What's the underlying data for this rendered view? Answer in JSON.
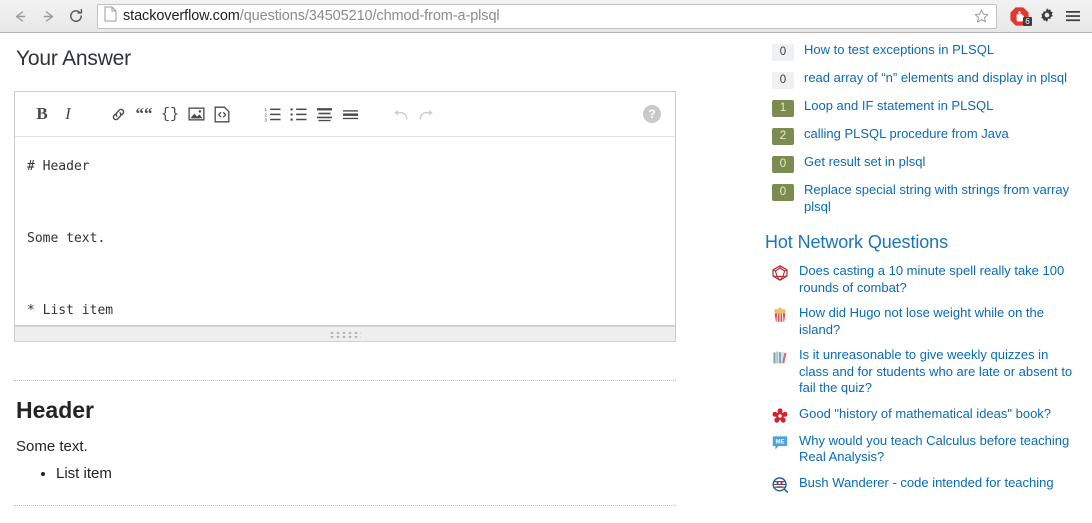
{
  "browser": {
    "back_label": "Back",
    "forward_label": "Forward",
    "reload_label": "Reload",
    "url_host": "stackoverflow.com",
    "url_path": "/questions/34505210/chmod-from-a-plsql",
    "page_icon": "document-icon",
    "star_label": "Bookmark",
    "extension": {
      "name": "adblock-icon",
      "badge": "6"
    },
    "settings_label": "Settings",
    "menu_label": "Menu"
  },
  "answer": {
    "heading": "Your Answer",
    "toolbar": [
      {
        "name": "bold",
        "glyph": "B"
      },
      {
        "name": "italic",
        "glyph": "I"
      },
      {
        "name": "link",
        "glyph": ""
      },
      {
        "name": "blockquote",
        "glyph": "““"
      },
      {
        "name": "code",
        "glyph": "{}"
      },
      {
        "name": "image",
        "glyph": ""
      },
      {
        "name": "code-snippet",
        "glyph": ""
      },
      {
        "name": "numbered-list",
        "glyph": ""
      },
      {
        "name": "bulleted-list",
        "glyph": ""
      },
      {
        "name": "heading",
        "glyph": ""
      },
      {
        "name": "horizontal-rule",
        "glyph": ""
      },
      {
        "name": "undo",
        "glyph": ""
      },
      {
        "name": "redo",
        "glyph": ""
      }
    ],
    "help_glyph": "?",
    "editor_text": "# Header\n\nSome text.\n\n* List item",
    "preview": {
      "heading": "Header",
      "paragraph": "Some text.",
      "list_items": [
        "List item"
      ]
    }
  },
  "sidebar": {
    "related": [
      {
        "votes": "0",
        "answered": false,
        "title": "How to test exceptions in PLSQL"
      },
      {
        "votes": "0",
        "answered": false,
        "title": "read array of “n” elements and display in plsql"
      },
      {
        "votes": "1",
        "answered": true,
        "title": "Loop and IF statement in PLSQL"
      },
      {
        "votes": "2",
        "answered": true,
        "title": "calling PLSQL procedure from Java"
      },
      {
        "votes": "0",
        "answered": true,
        "title": "Get result set in plsql"
      },
      {
        "votes": "0",
        "answered": true,
        "title": "Replace special string with strings from varray plsql"
      }
    ],
    "hot_network": {
      "title": "Hot Network Questions",
      "items": [
        {
          "icon": "rpg-d20-icon",
          "title": "Does casting a 10 minute spell really take 100 rounds of combat?"
        },
        {
          "icon": "popcorn-icon",
          "title": "How did Hugo not lose weight while on the island?"
        },
        {
          "icon": "books-icon",
          "title": "Is it unreasonable to give weekly quizzes in class and for students who are late or absent to fail the quiz?"
        },
        {
          "icon": "red-flower-icon",
          "title": "Good \"history of mathematical ideas\" book?"
        },
        {
          "icon": "math-educators-icon",
          "title": "Why would you teach Calculus before teaching Real Analysis?"
        },
        {
          "icon": "code-review-icon",
          "title": "Bush Wanderer - code intended for teaching"
        }
      ]
    }
  },
  "colors": {
    "link": "#0a6ab5",
    "hnq_heading": "#1b75bb",
    "vote_answered_bg": "#7c8b52",
    "vote_answered_text": "#e7efb5",
    "vote_zero_bg": "#eff0f1"
  }
}
